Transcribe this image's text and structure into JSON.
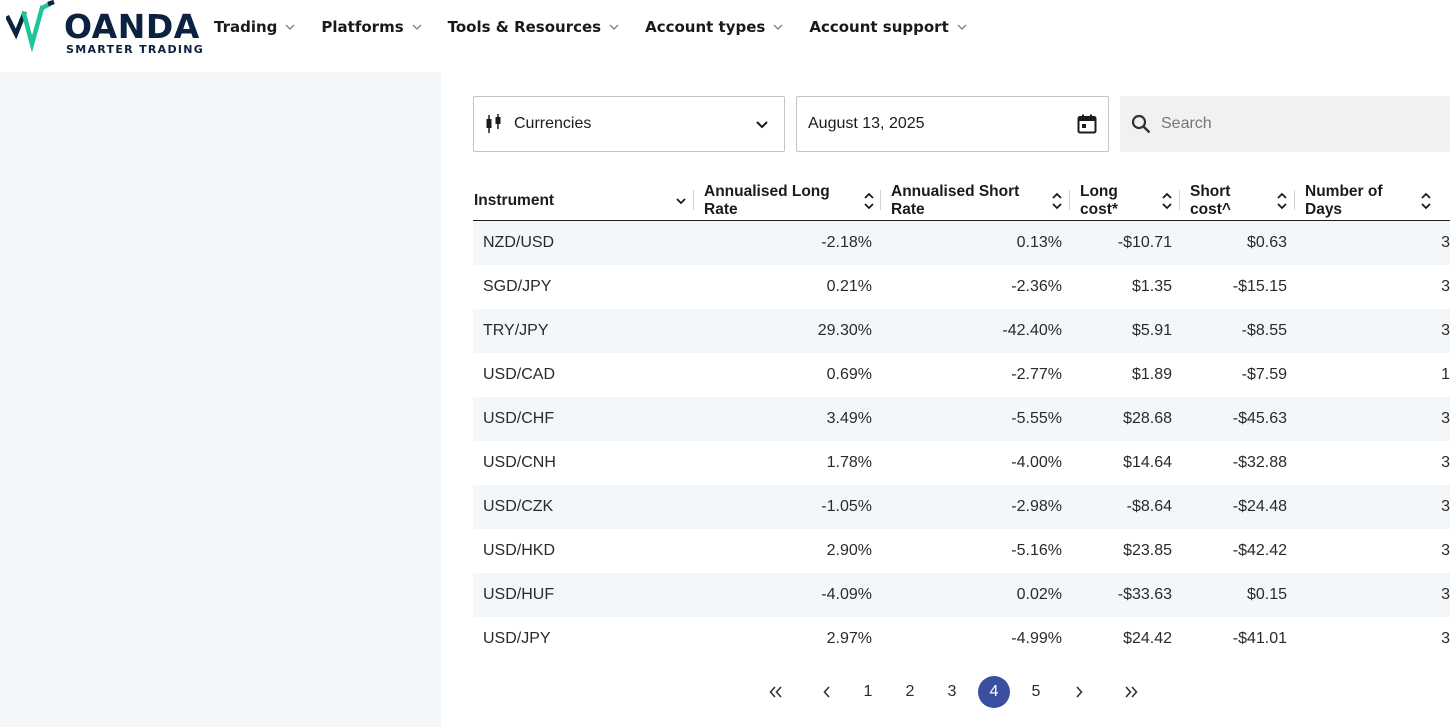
{
  "brand": {
    "name": "OANDA",
    "tagline": "SMARTER TRADING",
    "colors": {
      "navy": "#0d2240",
      "green": "#1fc59a",
      "active_page": "#3b4fa2"
    }
  },
  "nav": [
    {
      "label": "Trading"
    },
    {
      "label": "Platforms"
    },
    {
      "label": "Tools & Resources"
    },
    {
      "label": "Account types"
    },
    {
      "label": "Account support"
    }
  ],
  "filters": {
    "instrument_type": "Currencies",
    "date": "August 13, 2025",
    "search_placeholder": "Search",
    "icons": {
      "instrument": "candlestick-icon",
      "date": "calendar-icon",
      "search": "search-icon"
    }
  },
  "table": {
    "columns": [
      {
        "label_lines": [
          "Instrument"
        ]
      },
      {
        "label_lines": [
          "Annualised Long",
          "Rate"
        ]
      },
      {
        "label_lines": [
          "Annualised Short",
          "Rate"
        ]
      },
      {
        "label_lines": [
          "Long",
          "cost*"
        ]
      },
      {
        "label_lines": [
          "Short",
          "cost^"
        ]
      },
      {
        "label_lines": [
          "Number of",
          "Days"
        ]
      }
    ],
    "rows": [
      [
        "NZD/USD",
        "-2.18%",
        "0.13%",
        "-$10.71",
        "$0.63",
        "3"
      ],
      [
        "SGD/JPY",
        "0.21%",
        "-2.36%",
        "$1.35",
        "-$15.15",
        "3"
      ],
      [
        "TRY/JPY",
        "29.30%",
        "-42.40%",
        "$5.91",
        "-$8.55",
        "3"
      ],
      [
        "USD/CAD",
        "0.69%",
        "-2.77%",
        "$1.89",
        "-$7.59",
        "1"
      ],
      [
        "USD/CHF",
        "3.49%",
        "-5.55%",
        "$28.68",
        "-$45.63",
        "3"
      ],
      [
        "USD/CNH",
        "1.78%",
        "-4.00%",
        "$14.64",
        "-$32.88",
        "3"
      ],
      [
        "USD/CZK",
        "-1.05%",
        "-2.98%",
        "-$8.64",
        "-$24.48",
        "3"
      ],
      [
        "USD/HKD",
        "2.90%",
        "-5.16%",
        "$23.85",
        "-$42.42",
        "3"
      ],
      [
        "USD/HUF",
        "-4.09%",
        "0.02%",
        "-$33.63",
        "$0.15",
        "3"
      ],
      [
        "USD/JPY",
        "2.97%",
        "-4.99%",
        "$24.42",
        "-$41.01",
        "3"
      ]
    ]
  },
  "pagination": {
    "pages": [
      "1",
      "2",
      "3",
      "4",
      "5"
    ],
    "current": "4"
  }
}
